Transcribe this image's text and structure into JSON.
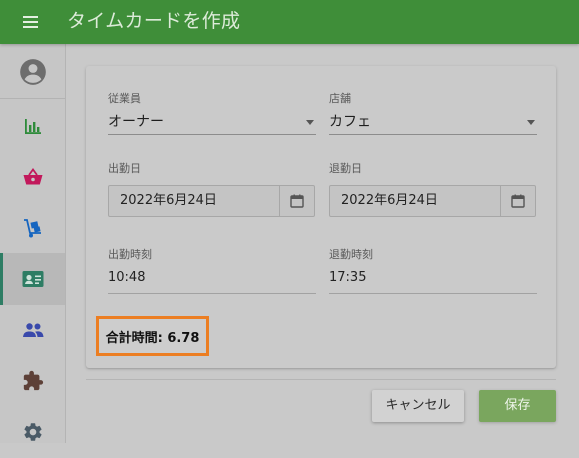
{
  "appbar": {
    "title": "タイムカードを作成"
  },
  "sidebar": {
    "items": [
      {
        "name": "account",
        "icon": "account-circle-icon"
      },
      {
        "name": "reports",
        "icon": "bar-chart-icon"
      },
      {
        "name": "sales",
        "icon": "shopping-basket-icon"
      },
      {
        "name": "inventory",
        "icon": "hand-truck-icon"
      },
      {
        "name": "timecards",
        "icon": "id-card-icon",
        "active": true
      },
      {
        "name": "employees",
        "icon": "people-icon"
      },
      {
        "name": "extensions",
        "icon": "puzzle-icon"
      },
      {
        "name": "settings",
        "icon": "gear-icon"
      }
    ]
  },
  "form": {
    "employee": {
      "label": "従業員",
      "value": "オーナー"
    },
    "store": {
      "label": "店舗",
      "value": "カフェ"
    },
    "clock_in_date": {
      "label": "出勤日",
      "value": "2022年6月24日"
    },
    "clock_out_date": {
      "label": "退勤日",
      "value": "2022年6月24日"
    },
    "clock_in_time": {
      "label": "出勤時刻",
      "value": "10:48"
    },
    "clock_out_time": {
      "label": "退勤時刻",
      "value": "17:35"
    },
    "total": "合計時間: 6.78"
  },
  "actions": {
    "cancel": "キャンセル",
    "save": "保存"
  },
  "colors": {
    "appbar": "#3f8e39",
    "accent_active": "#2e7d64",
    "highlight_border": "#ec7e22",
    "save_button": "#7aa65e",
    "reports_icon": "#2e8b3a",
    "sales_icon": "#c2185b",
    "inventory_icon": "#1565c0",
    "timecards_icon": "#2e7d64",
    "employees_icon": "#3949ab",
    "extensions_icon": "#5d4037",
    "settings_icon": "#4a5a66"
  }
}
